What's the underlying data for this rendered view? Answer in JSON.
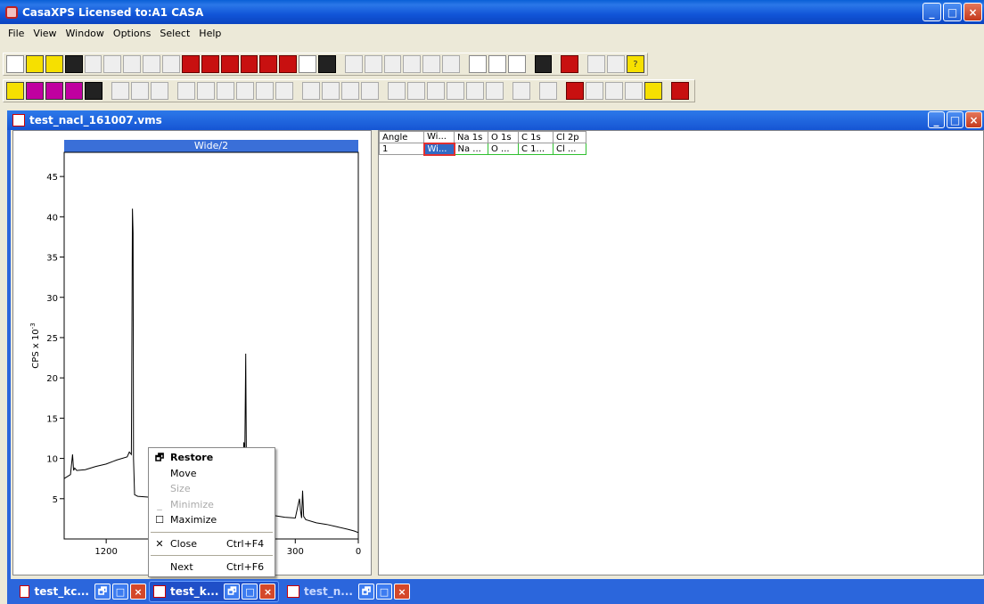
{
  "app": {
    "title": "CasaXPS Licensed to:A1 CASA"
  },
  "menu": [
    "File",
    "View",
    "Window",
    "Options",
    "Select",
    "Help"
  ],
  "document": {
    "title": "test_nacl_161007.vms"
  },
  "plot": {
    "title": "Wide/2",
    "ylabel": "CPS x 10",
    "ylabel_exp": "-3"
  },
  "chart_data": {
    "type": "line",
    "title": "Wide/2",
    "xlabel": "",
    "ylabel": "CPS x 10-3",
    "xlim": [
      1400,
      0
    ],
    "ylim": [
      0,
      48
    ],
    "x_ticks": [
      1200,
      300,
      0
    ],
    "y_ticks": [
      5,
      10,
      15,
      20,
      25,
      30,
      35,
      40,
      45
    ],
    "x_tick_labels": [
      "1200",
      "300",
      "0"
    ],
    "y_tick_labels": [
      "5",
      "10",
      "15",
      "20",
      "25",
      "30",
      "35",
      "40",
      "45"
    ],
    "series": [
      {
        "x": [
          1400,
          1370,
          1360,
          1355,
          1350,
          1340,
          1300,
          1250,
          1200,
          1150,
          1100,
          1090,
          1080,
          1075,
          1072,
          1070,
          1065,
          1050,
          1000,
          950,
          900,
          850,
          800,
          750,
          700,
          650,
          600,
          550,
          545,
          540,
          536,
          533,
          530,
          525,
          500,
          450,
          400,
          350,
          300,
          280,
          275,
          270,
          265,
          260,
          250,
          200,
          150,
          100,
          50,
          20,
          0
        ],
        "y": [
          7.5,
          8.0,
          10.5,
          8.5,
          8.8,
          8.5,
          8.6,
          9.0,
          9.3,
          9.8,
          10.2,
          10.8,
          10.5,
          41.0,
          38.0,
          10.0,
          5.5,
          5.3,
          5.2,
          5.0,
          4.8,
          4.6,
          4.5,
          4.3,
          4.1,
          3.9,
          3.8,
          4.5,
          12.0,
          11.0,
          23.0,
          10.0,
          4.5,
          3.5,
          3.3,
          3.1,
          2.9,
          2.7,
          2.6,
          5.0,
          3.5,
          2.6,
          6.0,
          2.8,
          2.4,
          2.0,
          1.8,
          1.5,
          1.2,
          1.0,
          0.8
        ]
      }
    ]
  },
  "table": {
    "headers": [
      "Angle",
      "Wi...",
      "Na 1s",
      "O 1s",
      "C 1s",
      "Cl 2p"
    ],
    "row": [
      "1",
      "Wi...",
      "Na ...",
      "O ...",
      "C 1...",
      "Cl ..."
    ]
  },
  "context_menu": {
    "restore": "Restore",
    "move": "Move",
    "size": "Size",
    "minimize": "Minimize",
    "maximize": "Maximize",
    "close": "Close",
    "close_accel": "Ctrl+F4",
    "next": "Next",
    "next_accel": "Ctrl+F6"
  },
  "minimized": [
    "test_kc...",
    "test_k...",
    "test_n..."
  ]
}
